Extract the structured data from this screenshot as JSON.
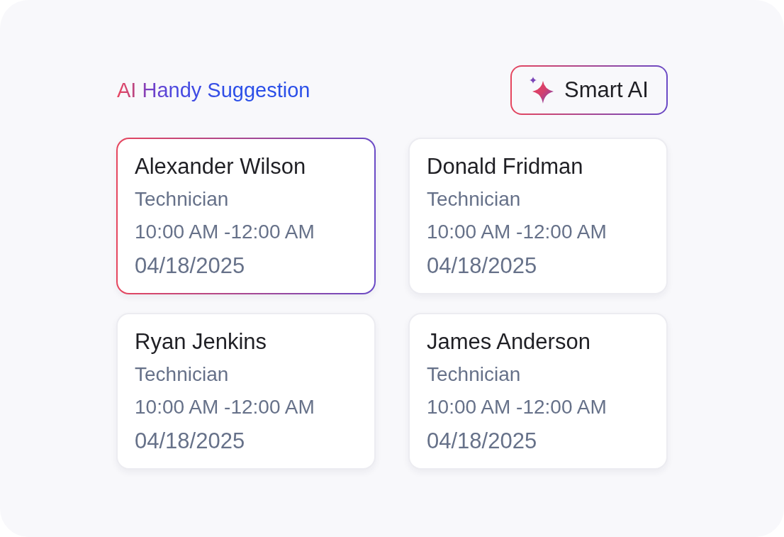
{
  "header": {
    "title": "AI Handy Suggestion",
    "button": {
      "label": "Smart AI"
    }
  },
  "cards": [
    {
      "name": "Alexander Wilson",
      "role": "Technician",
      "time": "10:00 AM -12:00 AM",
      "date": "04/18/2025",
      "selected": true
    },
    {
      "name": "Donald Fridman",
      "role": "Technician",
      "time": "10:00 AM -12:00 AM",
      "date": "04/18/2025",
      "selected": false
    },
    {
      "name": "Ryan Jenkins",
      "role": "Technician",
      "time": "10:00 AM -12:00 AM",
      "date": "04/18/2025",
      "selected": false
    },
    {
      "name": "James Anderson",
      "role": "Technician",
      "time": "10:00 AM -12:00 AM",
      "date": "04/18/2025",
      "selected": false
    }
  ]
}
